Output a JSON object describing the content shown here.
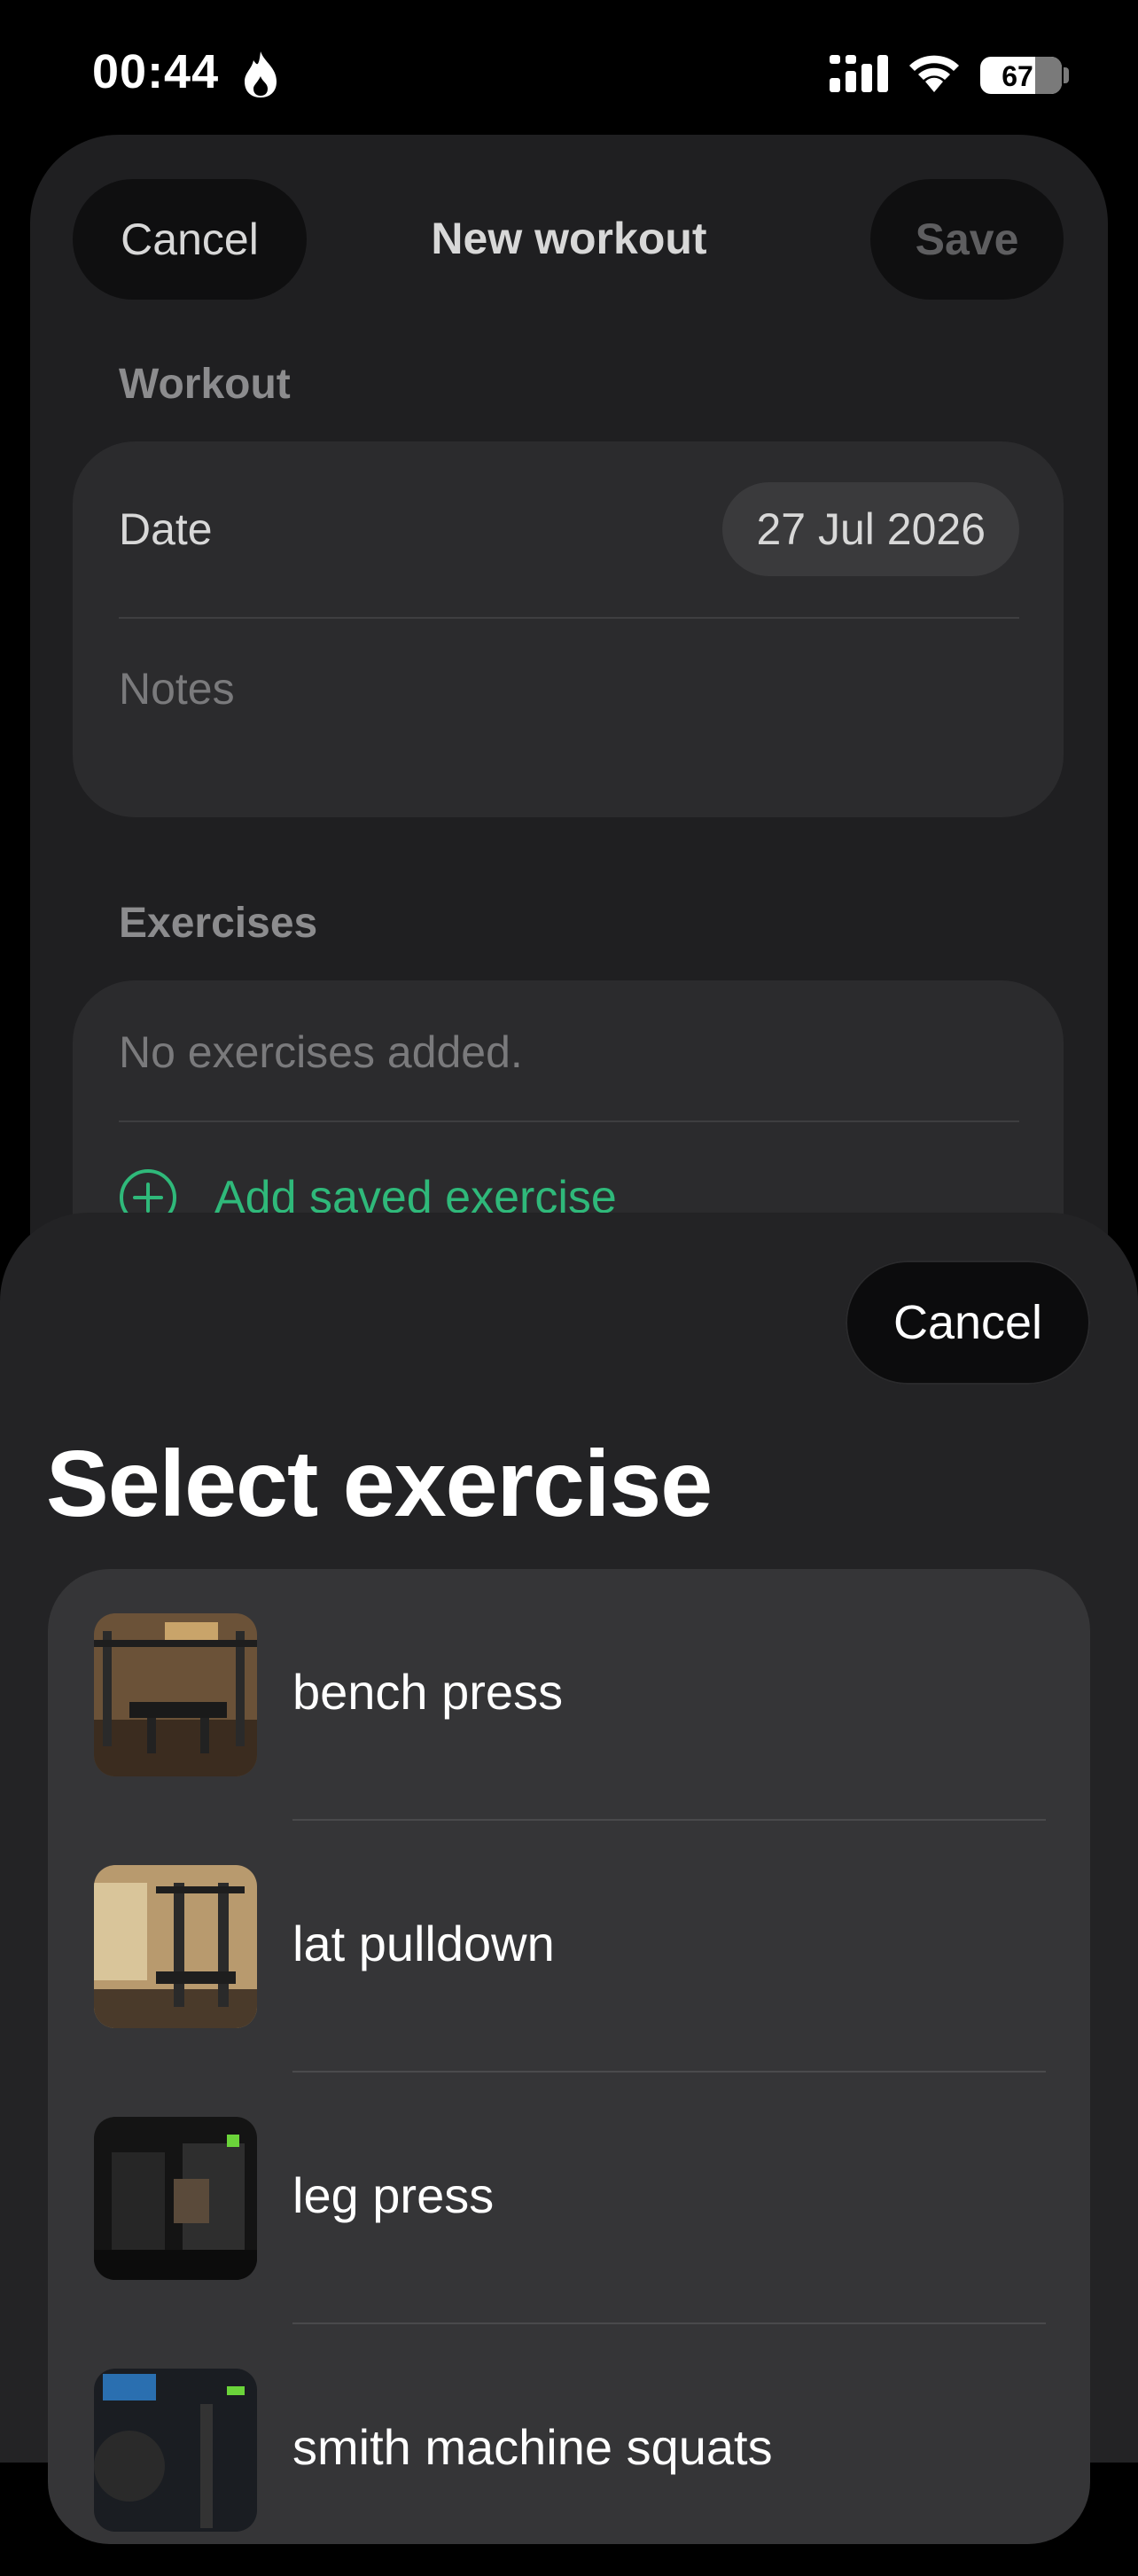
{
  "status_bar": {
    "time": "00:44",
    "battery": "67",
    "battery_level": 0.67
  },
  "new_workout_sheet": {
    "cancel_label": "Cancel",
    "title": "New workout",
    "save_label": "Save",
    "workout_section": "Workout",
    "date_label": "Date",
    "date_value": "27 Jul 2026",
    "notes_placeholder": "Notes",
    "exercises_section": "Exercises",
    "empty_text": "No exercises added.",
    "add_saved_label": "Add saved exercise"
  },
  "select_sheet": {
    "cancel_label": "Cancel",
    "title": "Select exercise",
    "items": [
      {
        "label": "bench press"
      },
      {
        "label": "lat pulldown"
      },
      {
        "label": "leg press"
      },
      {
        "label": "smith machine squats"
      }
    ]
  },
  "colors": {
    "accent_green": "#2fb97a",
    "sheet_bg": "#232325",
    "card_bg": "#353537"
  }
}
